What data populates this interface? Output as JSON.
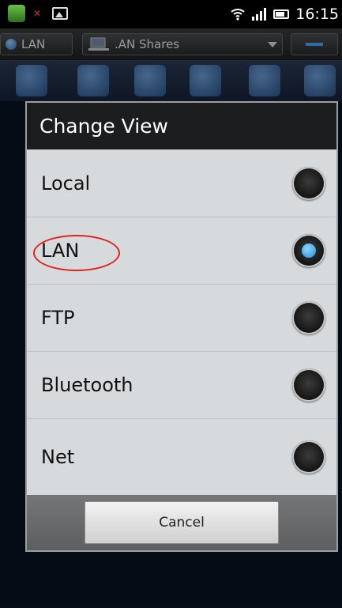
{
  "statusbar": {
    "time": "16:15"
  },
  "toolbar": {
    "lan_label": "LAN",
    "share_label": ".AN Shares"
  },
  "dialog": {
    "title": "Change View",
    "options": [
      {
        "label": "Local",
        "selected": false
      },
      {
        "label": "LAN",
        "selected": true
      },
      {
        "label": "FTP",
        "selected": false
      },
      {
        "label": "Bluetooth",
        "selected": false
      },
      {
        "label": "Net",
        "selected": false
      }
    ],
    "cancel_label": "Cancel"
  },
  "colors": {
    "accent": "#1e8fd9",
    "annotation": "#e0221c",
    "title_bg": "#1c1d1f",
    "dialog_bg": "#d7dadd"
  }
}
